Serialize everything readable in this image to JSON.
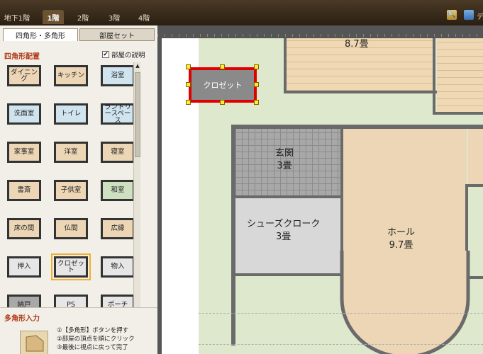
{
  "topbar": {
    "floors": [
      "地下1階",
      "1階",
      "2階",
      "3階",
      "4階"
    ],
    "active_floor": "1階",
    "right_label": "デ"
  },
  "panel": {
    "tabs": [
      "四角形・多角形",
      "部屋セット"
    ],
    "section_rect": "四角形配置",
    "show_desc_label": "部屋の説明",
    "room_buttons": [
      {
        "label": "ダイニング",
        "color": "#ecd6b6"
      },
      {
        "label": "キッチン",
        "color": "#ecd6b6"
      },
      {
        "label": "浴室",
        "color": "#d0e4f0"
      },
      {
        "label": "洗面室",
        "color": "#d0e4f0"
      },
      {
        "label": "トイレ",
        "color": "#d0e4f0"
      },
      {
        "label": "ランドリースペース",
        "color": "#d0e4f0"
      },
      {
        "label": "家事室",
        "color": "#ecd6b6"
      },
      {
        "label": "洋室",
        "color": "#ecd6b6"
      },
      {
        "label": "寝室",
        "color": "#ecd6b6"
      },
      {
        "label": "書斎",
        "color": "#ecd6b6"
      },
      {
        "label": "子供室",
        "color": "#ecd6b6"
      },
      {
        "label": "和室",
        "color": "#cde0c0"
      },
      {
        "label": "床の間",
        "color": "#ecd6b6"
      },
      {
        "label": "仏間",
        "color": "#ecd6b6"
      },
      {
        "label": "広縁",
        "color": "#ecd6b6"
      },
      {
        "label": "押入",
        "color": "#e6e6e6"
      },
      {
        "label": "クロゼット",
        "color": "#e6e6e6"
      },
      {
        "label": "物入",
        "color": "#e6e6e6"
      },
      {
        "label": "納戸",
        "color": "#a8a8a8"
      },
      {
        "label": "PS",
        "color": "#e6e6e6"
      },
      {
        "label": "ポーチ",
        "color": "#e6e6e6"
      }
    ],
    "selected_button": "クロゼット",
    "section_poly": "多角形入力",
    "poly_steps": [
      "①【多角形】ボタンを押す",
      "②部屋の頂点を順にクリック",
      "③最後に視点に戻って完了"
    ]
  },
  "plan": {
    "rooms": [
      {
        "name": "8.7畳",
        "area": ""
      },
      {
        "name": "玄関",
        "area": "3畳"
      },
      {
        "name": "シューズクローク",
        "area": "3畳"
      },
      {
        "name": "ホール",
        "area": "9.7畳"
      }
    ],
    "selected_room": "クロゼット"
  }
}
